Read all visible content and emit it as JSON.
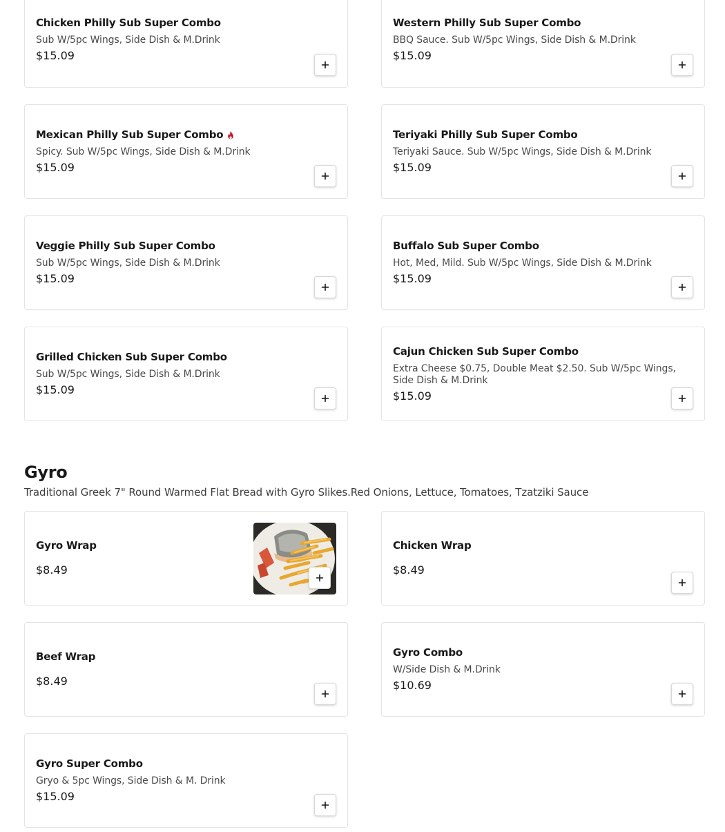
{
  "sub_combos": [
    {
      "name": "Chicken Philly Sub Super Combo",
      "desc": "Sub W/5pc Wings, Side Dish & M.Drink",
      "price": "$15.09"
    },
    {
      "name": "Western Philly Sub Super Combo",
      "desc": "BBQ Sauce. Sub W/5pc Wings, Side Dish & M.Drink",
      "price": "$15.09"
    },
    {
      "name": "Mexican Philly Sub Super Combo",
      "desc": "Spicy. Sub W/5pc Wings, Side Dish & M.Drink",
      "price": "$15.09",
      "icon": "fire-icon"
    },
    {
      "name": "Teriyaki Philly Sub Super Combo",
      "desc": "Teriyaki Sauce. Sub W/5pc Wings, Side Dish & M.Drink",
      "price": "$15.09"
    },
    {
      "name": "Veggie Philly Sub Super Combo",
      "desc": "Sub W/5pc Wings, Side Dish & M.Drink",
      "price": "$15.09"
    },
    {
      "name": "Buffalo Sub Super Combo",
      "desc": "Hot, Med, Mild. Sub W/5pc Wings, Side Dish & M.Drink",
      "price": "$15.09"
    },
    {
      "name": "Grilled Chicken Sub Super Combo",
      "desc": "Sub W/5pc Wings, Side Dish & M.Drink",
      "price": "$15.09"
    },
    {
      "name": "Cajun Chicken Sub Super Combo",
      "desc": "Extra Cheese $0.75, Double Meat $2.50. Sub W/5pc Wings, Side Dish & M.Drink",
      "price": "$15.09"
    }
  ],
  "gyro": {
    "title": "Gyro",
    "description": "Traditional Greek 7\" Round Warmed Flat Bread with Gyro Slikes.Red Onions, Lettuce, Tomatoes, Tzatziki Sauce",
    "items": [
      {
        "name": "Gyro Wrap",
        "price": "$8.49"
      },
      {
        "name": "Chicken Wrap",
        "price": "$8.49"
      },
      {
        "name": "Beef Wrap",
        "price": "$8.49"
      },
      {
        "name": "Gyro Combo",
        "desc": "W/Side Dish & M.Drink",
        "price": "$10.69"
      },
      {
        "name": "Gyro Super Combo",
        "desc": "Gryo & 5pc Wings, Side Dish & M. Drink",
        "price": "$15.09"
      }
    ]
  },
  "icons": {
    "add": "plus-icon",
    "spicy": "fire-icon"
  },
  "colors": {
    "spicy": "#c8102e",
    "text": "#191919",
    "border": "#e4e4e4"
  }
}
